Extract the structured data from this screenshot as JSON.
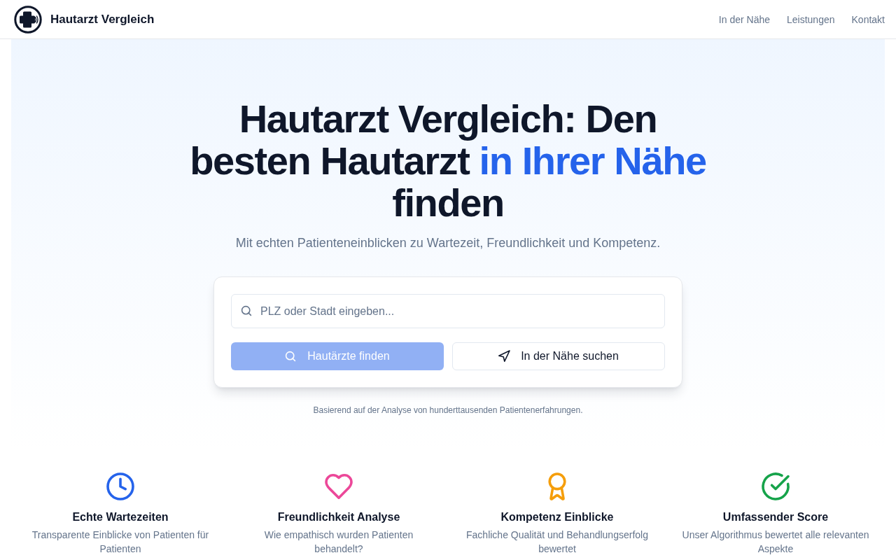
{
  "header": {
    "brand": "Hautarzt Vergleich",
    "nav": [
      "In der Nähe",
      "Leistungen",
      "Kontakt"
    ]
  },
  "hero": {
    "title_parts": [
      {
        "text": "Hautarzt Vergleich: Den besten Hautarzt",
        "highlight": false
      },
      {
        "text": "in Ihrer Nähe",
        "highlight": true
      },
      {
        "text": "finden",
        "highlight": false
      }
    ],
    "subtitle": "Mit echten Patienteneinblicken zu Wartezeit, Freundlichkeit und Kompetenz.",
    "search": {
      "placeholder": "PLZ oder Stadt eingeben...",
      "buttons": [
        {
          "label": "Hautärzte finden",
          "kind": "primary",
          "disabled": true
        },
        {
          "label": "In der Nähe suchen",
          "kind": "secondary",
          "disabled": false
        }
      ]
    },
    "note": "Basierend auf der Analyse von hunderttausenden Patientenerfahrungen."
  },
  "features": [
    {
      "title": "Echte Wartezeiten",
      "description": "Transparente Einblicke von Patienten für Patienten",
      "color": "#2563eb"
    },
    {
      "title": "Freundlichkeit Analyse",
      "description": "Wie empathisch wurden Patienten behandelt?",
      "color": "#ec4899"
    },
    {
      "title": "Kompetenz Einblicke",
      "description": "Fachliche Qualität und Behandlungserfolg bewertet",
      "color": "#f59e0b"
    },
    {
      "title": "Umfassender Score",
      "description": "Unser Algorithmus bewertet alle relevanten Aspekte",
      "color": "#16a34a"
    }
  ]
}
